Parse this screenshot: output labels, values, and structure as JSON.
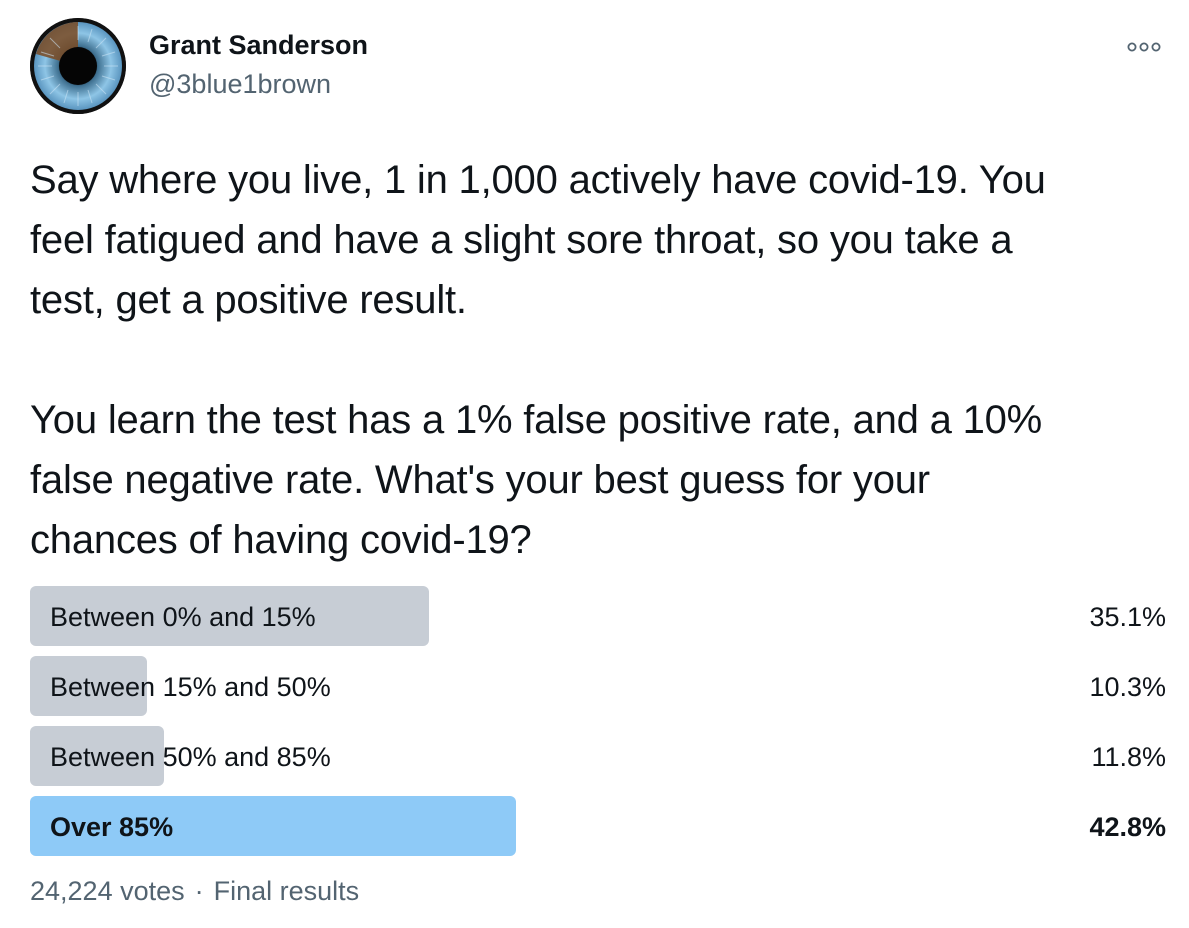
{
  "author": {
    "name": "Grant Sanderson",
    "handle": "@3blue1brown",
    "avatar_icon": "3blue1brown-eye-logo"
  },
  "more_icon": "more-options-icon",
  "tweet": {
    "paragraph1": "Say where you live, 1 in 1,000 actively have covid-19. You\nfeel fatigued and have a slight sore throat, so you take a\ntest, get a positive result.",
    "paragraph2": "You learn the test has a 1% false positive rate, and a 10%\nfalse negative rate.  What's your best guess for your\nchances of having covid-19?"
  },
  "poll": {
    "options": [
      {
        "label": "Between 0% and 15%",
        "percent_text": "35.1%",
        "percent": 35.1,
        "winner": false
      },
      {
        "label": "Between 15% and 50%",
        "percent_text": "10.3%",
        "percent": 10.3,
        "winner": false
      },
      {
        "label": "Between 50% and 85%",
        "percent_text": "11.8%",
        "percent": 11.8,
        "winner": false
      },
      {
        "label": "Over 85%",
        "percent_text": "42.8%",
        "percent": 42.8,
        "winner": true
      }
    ],
    "votes": "24,224 votes",
    "separator": "·",
    "status": "Final results"
  },
  "colors": {
    "bar": "#c7cdd5",
    "winner_bar": "#8ecaf7",
    "secondary_text": "#536471"
  }
}
